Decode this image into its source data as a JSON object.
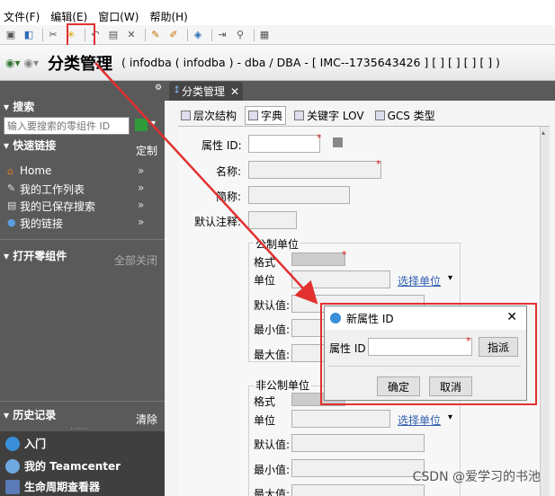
{
  "menubar": {
    "items": [
      "文件(F)",
      "编辑(E)",
      "窗口(W)",
      "帮助(H)"
    ]
  },
  "header": {
    "title": "分类管理",
    "context": "( infodba ( infodba ) - dba / DBA - [ IMC--1735643426 ] [ ] [ ] [ ] [ ] )"
  },
  "left": {
    "search_title": "搜索",
    "search_placeholder": "输入要搜索的零组件 ID",
    "quicklinks_title": "快速链接",
    "quicklinks_custom": "定制",
    "links": [
      "Home",
      "我的工作列表",
      "我的已保存搜索",
      "我的链接"
    ],
    "open_title": "打开零组件",
    "open_closeall": "全部关闭",
    "history_title": "历史记录",
    "history_clear": "清除",
    "bottom": [
      "入门",
      "我的 Teamcenter",
      "生命周期查看器"
    ]
  },
  "tab": {
    "label": "分类管理"
  },
  "subtabs": [
    "层次结构",
    "字典",
    "关键字 LOV",
    "GCS 类型"
  ],
  "form": {
    "attr_id": "属性 ID:",
    "name": "名称:",
    "short_name": "简称:",
    "default_note": "默认注释:",
    "metric_group": "公制单位",
    "nonmetric_group": "非公制单位",
    "format": "格式",
    "unit": "单位",
    "select_unit": "选择单位",
    "default_val": "默认值:",
    "min_val": "最小值:",
    "max_val": "最大值:"
  },
  "dialog": {
    "title": "新属性 ID",
    "field_label": "属性 ID",
    "assign": "指派",
    "ok": "确定",
    "cancel": "取消"
  },
  "watermark": "CSDN @爱学习的书池",
  "colors": {
    "highlight": "#e23030",
    "panel": "#5a5a5a"
  }
}
